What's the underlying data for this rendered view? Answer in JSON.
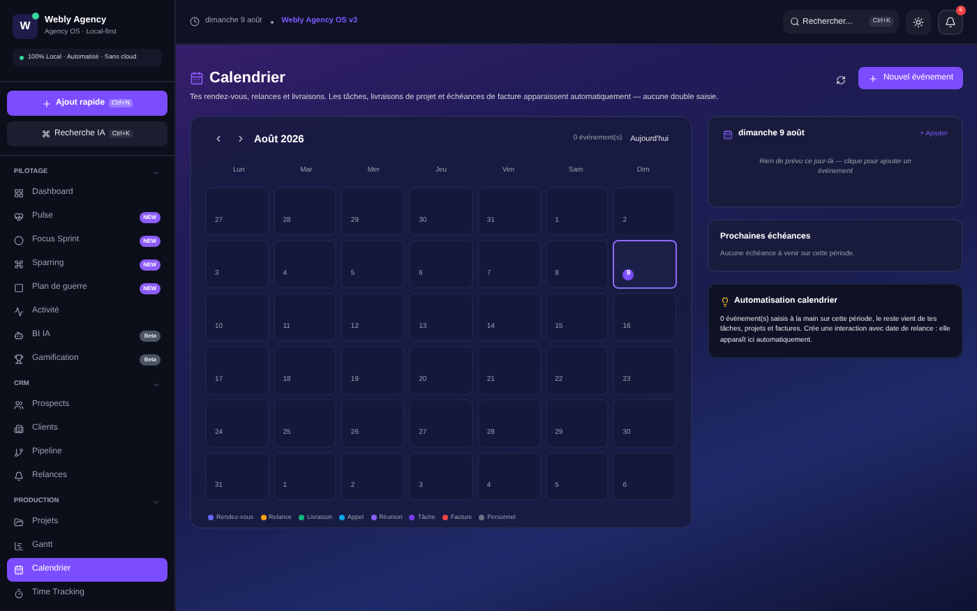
{
  "brand": {
    "name": "Webly Agency",
    "tagline": "Agency OS · Local-first",
    "logo": "W"
  },
  "status_pill": "100% Local · Automatisé · Sans cloud",
  "quick_add": {
    "label": "Ajout rapide",
    "shortcut": "Ctrl+N"
  },
  "ai_search": {
    "label": "Recherche IA",
    "shortcut": "Ctrl+K"
  },
  "sidebar": [
    {
      "title": "PILOTAGE",
      "expanded": true,
      "items": [
        {
          "label": "Dashboard",
          "selected": false
        },
        {
          "label": "Pulse",
          "selected": false,
          "badge": {
            "text": "NEW",
            "kind": "new"
          }
        },
        {
          "label": "Focus Sprint",
          "selected": false,
          "badge": {
            "text": "NEW",
            "kind": "new"
          }
        },
        {
          "label": "Sparring",
          "selected": false,
          "badge": {
            "text": "NEW",
            "kind": "new"
          }
        },
        {
          "label": "Plan de guerre",
          "selected": false,
          "badge": {
            "text": "NEW",
            "kind": "new"
          }
        },
        {
          "label": "Activité",
          "selected": false
        },
        {
          "label": "BI IA",
          "selected": false,
          "badge": {
            "text": "Beta",
            "kind": "beta"
          }
        },
        {
          "label": "Gamification",
          "selected": false,
          "badge": {
            "text": "Beta",
            "kind": "beta"
          }
        }
      ]
    },
    {
      "title": "CRM",
      "expanded": true,
      "items": [
        {
          "label": "Prospects",
          "selected": false
        },
        {
          "label": "Clients",
          "selected": false
        },
        {
          "label": "Pipeline",
          "selected": false
        },
        {
          "label": "Relances",
          "selected": false
        }
      ]
    },
    {
      "title": "PRODUCTION",
      "expanded": true,
      "items": [
        {
          "label": "Projets",
          "selected": false
        },
        {
          "label": "Gantt",
          "selected": false
        },
        {
          "label": "Calendrier",
          "selected": true
        },
        {
          "label": "Time Tracking",
          "selected": false
        }
      ]
    }
  ],
  "topbar": {
    "date": "dimanche 9 août",
    "version": "Webly Agency OS v3",
    "search": {
      "placeholder": "Rechercher...",
      "shortcut": "Ctrl+K"
    },
    "notifications": "6"
  },
  "header": {
    "title": "Calendrier",
    "subtitle": "Tes rendez-vous, relances et livraisons. Les tâches, livraisons de projet et échéances de facture apparaissent automatiquement — aucune double saisie.",
    "new_button": "Nouvel événement"
  },
  "calendar": {
    "month": "Août 2026",
    "event_count": "0 événement(s)",
    "today_button": "Aujourd'hui",
    "weekdays": [
      "Lun",
      "Mar",
      "Mer",
      "Jeu",
      "Ven",
      "Sam",
      "Dim"
    ],
    "days": [
      {
        "label": "27",
        "selected": false
      },
      {
        "label": "28",
        "selected": false
      },
      {
        "label": "29",
        "selected": false
      },
      {
        "label": "30",
        "selected": false
      },
      {
        "label": "31",
        "selected": false
      },
      {
        "label": "1",
        "selected": false
      },
      {
        "label": "2",
        "selected": false
      },
      {
        "label": "3",
        "selected": false
      },
      {
        "label": "4",
        "selected": false
      },
      {
        "label": "5",
        "selected": false
      },
      {
        "label": "6",
        "selected": false
      },
      {
        "label": "7",
        "selected": false
      },
      {
        "label": "8",
        "selected": false
      },
      {
        "label": "9",
        "selected": true
      },
      {
        "label": "10",
        "selected": false
      },
      {
        "label": "11",
        "selected": false
      },
      {
        "label": "12",
        "selected": false
      },
      {
        "label": "13",
        "selected": false
      },
      {
        "label": "14",
        "selected": false
      },
      {
        "label": "15",
        "selected": false
      },
      {
        "label": "16",
        "selected": false
      },
      {
        "label": "17",
        "selected": false
      },
      {
        "label": "18",
        "selected": false
      },
      {
        "label": "19",
        "selected": false
      },
      {
        "label": "20",
        "selected": false
      },
      {
        "label": "21",
        "selected": false
      },
      {
        "label": "22",
        "selected": false
      },
      {
        "label": "23",
        "selected": false
      },
      {
        "label": "24",
        "selected": false
      },
      {
        "label": "25",
        "selected": false
      },
      {
        "label": "26",
        "selected": false
      },
      {
        "label": "27",
        "selected": false
      },
      {
        "label": "28",
        "selected": false
      },
      {
        "label": "29",
        "selected": false
      },
      {
        "label": "30",
        "selected": false
      },
      {
        "label": "31",
        "selected": false
      },
      {
        "label": "1",
        "selected": false
      },
      {
        "label": "2",
        "selected": false
      },
      {
        "label": "3",
        "selected": false
      },
      {
        "label": "4",
        "selected": false
      },
      {
        "label": "5",
        "selected": false
      },
      {
        "label": "6",
        "selected": false
      }
    ],
    "legend": [
      {
        "label": "Rendez-vous",
        "color": "#6366f1"
      },
      {
        "label": "Relance",
        "color": "#f59e0b"
      },
      {
        "label": "Livraison",
        "color": "#10b981"
      },
      {
        "label": "Appel",
        "color": "#0ea5e9"
      },
      {
        "label": "Réunion",
        "color": "#8b5cf6"
      },
      {
        "label": "Tâche",
        "color": "#7c3aed"
      },
      {
        "label": "Facture",
        "color": "#ef4444"
      },
      {
        "label": "Personnel",
        "color": "#6b7280"
      }
    ]
  },
  "day_panel": {
    "title": "dimanche 9 août",
    "add_link": "+ Ajouter",
    "empty": "Rien de prévu ce jour-là — clique pour ajouter un événement"
  },
  "deadlines": {
    "title": "Prochaines échéances",
    "empty": "Aucune échéance à venir sur cette période."
  },
  "automation": {
    "title": "Automatisation calendrier",
    "body": "0 événement(s) saisis à la main sur cette période, le reste vient de tes tâches, projets et factures. Crée une interaction avec date de relance : elle apparaît ici automatiquement."
  }
}
